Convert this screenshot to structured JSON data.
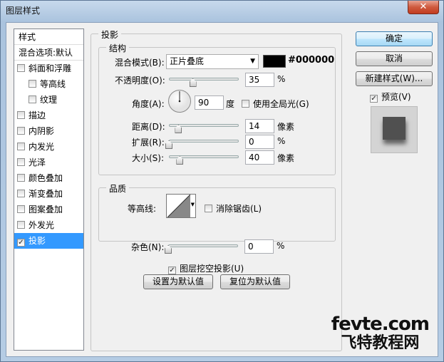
{
  "window": {
    "title": "图层样式",
    "close": "✕"
  },
  "left_list": {
    "header": "样式",
    "blend_options": "混合选项:默认",
    "items": [
      {
        "label": "斜面和浮雕",
        "checked": false,
        "sub": false
      },
      {
        "label": "等高线",
        "checked": false,
        "sub": true
      },
      {
        "label": "纹理",
        "checked": false,
        "sub": true
      },
      {
        "label": "描边",
        "checked": false,
        "sub": false
      },
      {
        "label": "内阴影",
        "checked": false,
        "sub": false
      },
      {
        "label": "内发光",
        "checked": false,
        "sub": false
      },
      {
        "label": "光泽",
        "checked": false,
        "sub": false
      },
      {
        "label": "颜色叠加",
        "checked": false,
        "sub": false
      },
      {
        "label": "渐变叠加",
        "checked": false,
        "sub": false
      },
      {
        "label": "图案叠加",
        "checked": false,
        "sub": false
      },
      {
        "label": "外发光",
        "checked": false,
        "sub": false
      },
      {
        "label": "投影",
        "checked": true,
        "sub": false,
        "selected": true
      }
    ]
  },
  "drop_shadow": {
    "title": "投影",
    "structure": {
      "title": "结构",
      "blend_mode_label": "混合模式(B):",
      "blend_mode_value": "正片叠底",
      "color_hex": "#000000",
      "opacity_label": "不透明度(O):",
      "opacity_value": "35",
      "opacity_unit": "%",
      "angle_label": "角度(A):",
      "angle_value": "90",
      "angle_unit": "度",
      "global_light_label": "使用全局光(G)",
      "global_light_checked": false,
      "distance_label": "距离(D):",
      "distance_value": "14",
      "distance_unit": "像素",
      "spread_label": "扩展(R):",
      "spread_value": "0",
      "spread_unit": "%",
      "size_label": "大小(S):",
      "size_value": "40",
      "size_unit": "像素"
    },
    "quality": {
      "title": "品质",
      "contour_label": "等高线:",
      "antialias_label": "消除锯齿(L)",
      "antialias_checked": false,
      "noise_label": "杂色(N):",
      "noise_value": "0",
      "noise_unit": "%"
    },
    "knockout_label": "图层挖空投影(U)",
    "knockout_checked": true,
    "set_default_label": "设置为默认值",
    "reset_default_label": "复位为默认值"
  },
  "buttons": {
    "ok": "确定",
    "cancel": "取消",
    "new_style": "新建样式(W)...",
    "preview_label": "预览(V)",
    "preview_checked": true
  },
  "watermark": {
    "line1": "fevte.com",
    "line2": "飞特教程网"
  },
  "colors": {
    "selection": "#3399ff",
    "shadow_color": "#000000",
    "preview_square": "#505050"
  }
}
